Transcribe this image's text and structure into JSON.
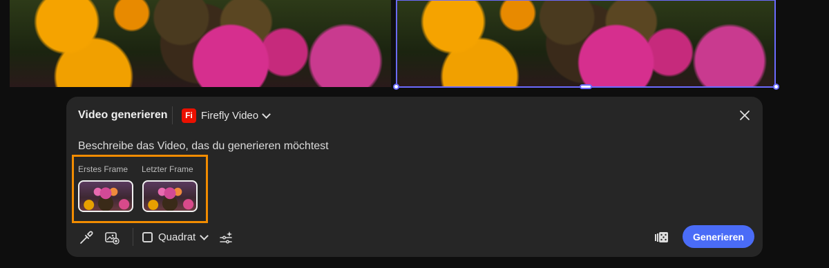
{
  "panel": {
    "title": "Video generieren",
    "model": {
      "logo_text": "Fi",
      "label": "Firefly Video"
    },
    "prompt_placeholder": "Beschreibe das Video, das du generieren möchtest",
    "frames": {
      "first_label": "Erstes Frame",
      "last_label": "Letzter Frame"
    },
    "toolbar": {
      "aspect_label": "Quadrat",
      "generate_label": "Generieren"
    }
  },
  "colors": {
    "accent": "#4a6cf7",
    "highlight": "#f28c00",
    "selection": "#6b6bff",
    "brand_logo": "#eb1000"
  },
  "icons": [
    "eyedropper-icon",
    "image-reference-icon",
    "aspect-ratio-icon",
    "chevron-down-icon",
    "magic-settings-icon",
    "shuffle-dice-icon",
    "close-icon"
  ]
}
